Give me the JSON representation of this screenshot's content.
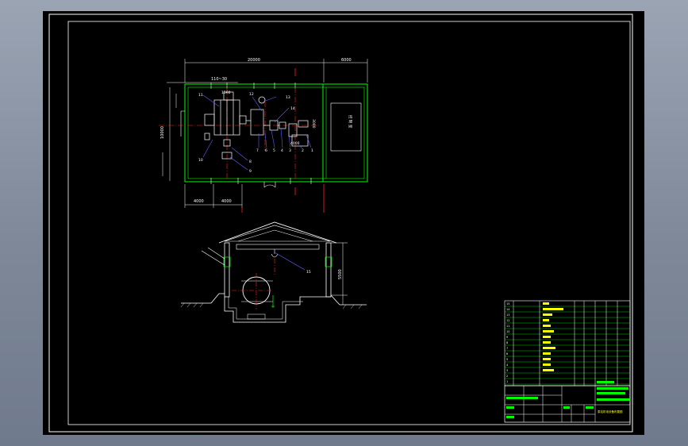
{
  "colors": {
    "background": "#000000",
    "frame": "#ffffff",
    "wall": "#00ff00",
    "centerline": "#ff2020",
    "leader": "#6060ff",
    "text_yellow": "#ffff00"
  },
  "plan": {
    "dim_total_width": "20000",
    "dim_right": "6000",
    "dim_top_small": "110~30",
    "dim_1560": "1560",
    "dim_bottom_left": "4000",
    "dim_bottom_mid": "4000",
    "dim_left_span": "10000",
    "dim_3000": "3000",
    "side_room_label": "控 制 室",
    "callouts": [
      "11",
      "12",
      "13",
      "14",
      "10",
      "8",
      "9",
      "7",
      "6",
      "5",
      "4",
      "3",
      "2",
      "1"
    ]
  },
  "section": {
    "callout": "15"
  },
  "title_block": {
    "row_numbers": [
      "15",
      "14",
      "13",
      "12",
      "11",
      "10",
      "9",
      "8",
      "7",
      "6",
      "5",
      "4",
      "3",
      "2",
      "1"
    ],
    "title": "泵站机电设备布置图"
  }
}
